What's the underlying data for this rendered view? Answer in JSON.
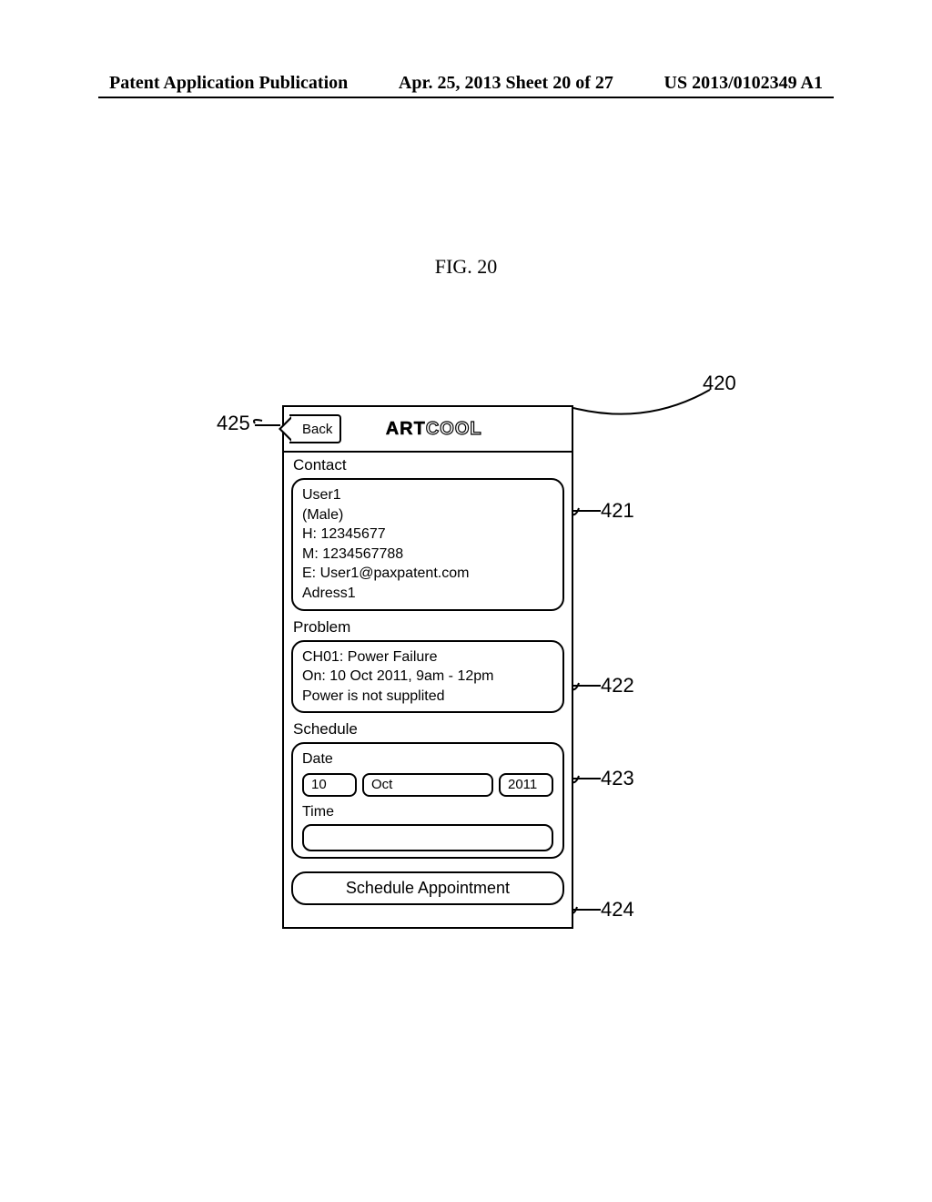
{
  "header": {
    "left": "Patent Application Publication",
    "center": "Apr. 25, 2013  Sheet 20 of 27",
    "right": "US 2013/0102349 A1"
  },
  "figure_label": "FIG. 20",
  "callouts": {
    "c420": "420",
    "c421": "421",
    "c422": "422",
    "c423": "423",
    "c424": "424",
    "c425": "425"
  },
  "titlebar": {
    "back": "Back",
    "brand_plain": "ART",
    "brand_outline": "COOL"
  },
  "sections": {
    "contact_header": "Contact",
    "contact": {
      "line1": "User1",
      "line2": "(Male)",
      "line3": "H: 12345677",
      "line4": "M: 1234567788",
      "line5": "E: User1@paxpatent.com",
      "line6": "Adress1"
    },
    "problem_header": "Problem",
    "problem": {
      "line1": "CH01: Power Failure",
      "line2": "On: 10 Oct 2011, 9am - 12pm",
      "line3": "Power is not supplited"
    },
    "schedule_header": "Schedule",
    "schedule": {
      "date_label": "Date",
      "day": "10",
      "month": "Oct",
      "year": "2011",
      "time_label": "Time"
    }
  },
  "button": {
    "schedule": "Schedule Appointment"
  }
}
